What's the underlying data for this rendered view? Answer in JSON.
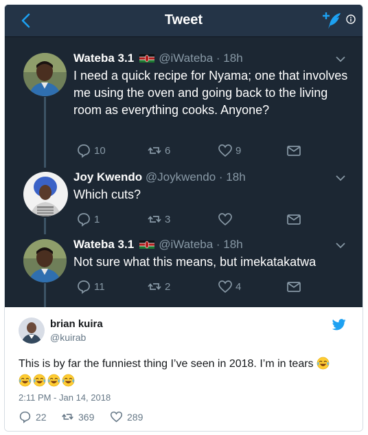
{
  "app": {
    "title": "Tweet",
    "colors": {
      "accent": "#1da1f2",
      "dark_bg": "#1c2733",
      "nav_bg": "#243447",
      "muted": "#8899a6"
    }
  },
  "thread": [
    {
      "name": "Wateba 3.1",
      "flag": "kenya-flag",
      "handle": "@iWateba",
      "time": "· 18h",
      "text": "I need a quick recipe for Nyama; one that involves me using the oven and going back to the living room as everything cooks. Anyone?",
      "replies": "10",
      "retweets": "6",
      "likes": "9"
    },
    {
      "name": "Joy Kwendo",
      "handle": "@Joykwendo",
      "time": "· 18h",
      "text": "Which cuts?",
      "replies": "1",
      "retweets": "3",
      "likes": ""
    },
    {
      "name": "Wateba 3.1",
      "flag": "kenya-flag",
      "handle": "@iWateba",
      "time": "· 18h",
      "text": "Not sure what this means, but imekatakatwa",
      "replies": "11",
      "retweets": "2",
      "likes": "4"
    }
  ],
  "quote": {
    "name": "brian kuira",
    "handle": "@kuirab",
    "text": "This is by far the funniest thing I’ve seen in 2018. I’m in tears",
    "emoji": "face-with-tears-of-joy",
    "time": "2:11 PM - Jan 14, 2018",
    "replies": "22",
    "retweets": "369",
    "likes": "289"
  }
}
